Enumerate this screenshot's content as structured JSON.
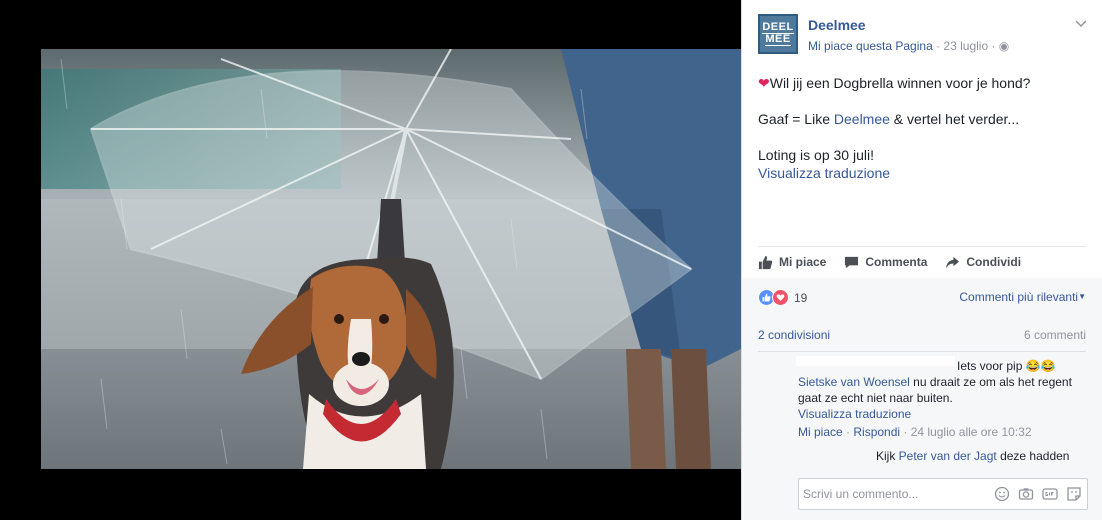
{
  "post": {
    "page_name": "Deelmee",
    "logo_line1": "DEEL",
    "logo_line2": "MEE",
    "like_page": "Mi piace questa Pagina",
    "separator": " · ",
    "date": "23 luglio",
    "separator2": " · ",
    "text_line1": "Wil jij een Dogbrella winnen voor je hond?",
    "text_line2_prefix": "Gaaf = Like ",
    "text_line2_link": "Deelmee",
    "text_line2_suffix": " & vertel het verder...",
    "text_line3": "Loting is op 30 juli!",
    "see_translation": "Visualizza traduzione"
  },
  "actions": {
    "like": "Mi piace",
    "comment": "Commenta",
    "share": "Condividi"
  },
  "reactions": {
    "count": "19",
    "sort_label": "Commenti più rilevanti"
  },
  "stats": {
    "shares": "2 condivisioni",
    "comments": "6 commenti"
  },
  "comments": {
    "c1_text": "Iets voor pip",
    "c1_emoji": "😂😂",
    "c2_author": "Sietske van Woensel",
    "c2_text_a": " nu draait ze om als het regent",
    "c2_text_b": "gaat ze echt niet naar buiten.",
    "c2_translation": "Visualizza traduzione",
    "c2_like": "Mi piace",
    "c2_dot": " · ",
    "c2_reply": "Rispondi",
    "c2_dot2": " · ",
    "c2_time": "24 luglio alle ore 10:32",
    "c3_prefix": "Kijk ",
    "c3_mention": "Peter van der Jagt",
    "c3_text": " deze hadden"
  },
  "composer": {
    "placeholder": "Scrivi un commento..."
  },
  "colors": {
    "link": "#365899",
    "like_blue": "#5890ff",
    "love_red": "#f25268"
  }
}
